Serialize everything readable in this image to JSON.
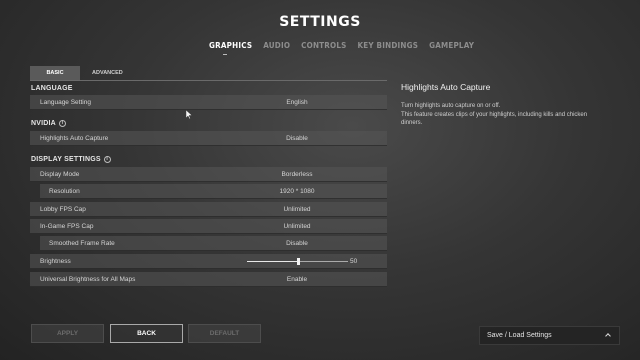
{
  "header": {
    "title": "SETTINGS",
    "tabs": [
      {
        "label": "GRAPHICS",
        "active": true
      },
      {
        "label": "AUDIO",
        "active": false
      },
      {
        "label": "CONTROLS",
        "active": false
      },
      {
        "label": "KEY BINDINGS",
        "active": false
      },
      {
        "label": "GAMEPLAY",
        "active": false
      }
    ]
  },
  "subtabs": {
    "basic": "BASIC",
    "advanced": "ADVANCED"
  },
  "sections": {
    "language": "LANGUAGE",
    "nvidia": "NVIDIA",
    "display": "DISPLAY SETTINGS"
  },
  "settings": {
    "language_setting": {
      "label": "Language Setting",
      "value": "English"
    },
    "highlights_auto_capture": {
      "label": "Highlights Auto Capture",
      "value": "Disable"
    },
    "display_mode": {
      "label": "Display Mode",
      "value": "Borderless"
    },
    "resolution": {
      "label": "Resolution",
      "value": "1920 * 1080"
    },
    "lobby_fps_cap": {
      "label": "Lobby FPS Cap",
      "value": "Unlimited"
    },
    "ingame_fps_cap": {
      "label": "In-Game FPS Cap",
      "value": "Unlimited"
    },
    "smoothed_frame_rate": {
      "label": "Smoothed Frame Rate",
      "value": "Disable"
    },
    "brightness": {
      "label": "Brightness",
      "value": "50",
      "fraction": 0.5
    },
    "universal_brightness": {
      "label": "Universal Brightness for All Maps",
      "value": "Enable"
    }
  },
  "info_panel": {
    "title": "Highlights Auto Capture",
    "line1": "Turn highlights auto capture on or off.",
    "line2": "This feature creates clips of your highlights, including kills and chicken",
    "line3": "dinners."
  },
  "footer": {
    "apply": "APPLY",
    "back": "BACK",
    "default": "DEFAULT",
    "save_load": "Save / Load Settings"
  }
}
